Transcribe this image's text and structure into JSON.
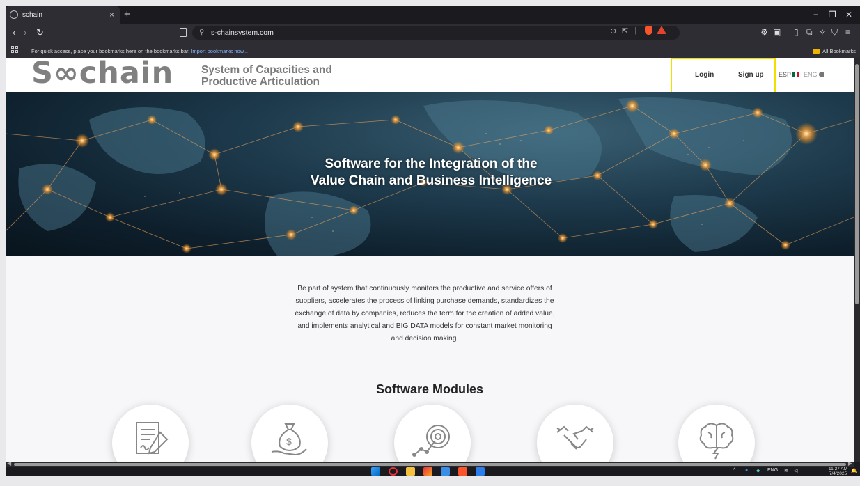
{
  "browser": {
    "tab_title": "schain",
    "tab_close": "×",
    "new_tab": "+",
    "url": "s-chainsystem.com",
    "bookmarks_hint": "For quick access, place your bookmarks here on the bookmarks bar.",
    "bookmarks_import": "Import bookmarks now...",
    "all_bookmarks": "All Bookmarks"
  },
  "header": {
    "logo": "S∞chain",
    "tagline_line1": "System of Capacities and",
    "tagline_line2": "Productive Articulation",
    "login": "Login",
    "signup": "Sign up",
    "lang_esp": "ESP",
    "lang_eng": "ENG"
  },
  "hero": {
    "title_line1": "Software for the Integration of the",
    "title_line2": "Value Chain and Business Intelligence"
  },
  "intro": {
    "text": "Be part of system that continuously monitors the productive and service offers of suppliers, accelerates the process of linking purchase demands, standardizes the exchange of data by companies, reduces the term for the creation of added value, and implements analytical and BIG DATA models for constant market monitoring and decision making."
  },
  "modules": {
    "title": "Software Modules",
    "items": [
      {
        "icon": "document-signature-icon"
      },
      {
        "icon": "money-bag-hand-icon"
      },
      {
        "icon": "target-growth-icon"
      },
      {
        "icon": "handshake-icon"
      },
      {
        "icon": "brain-lightning-icon"
      }
    ]
  },
  "taskbar": {
    "lang": "ENG",
    "time": "11:27 AM",
    "date": "7/4/2025"
  },
  "colors": {
    "highlight_box": "#f0e000",
    "hero_dark": "#0e1f2c",
    "network_orange": "#ffa640"
  }
}
